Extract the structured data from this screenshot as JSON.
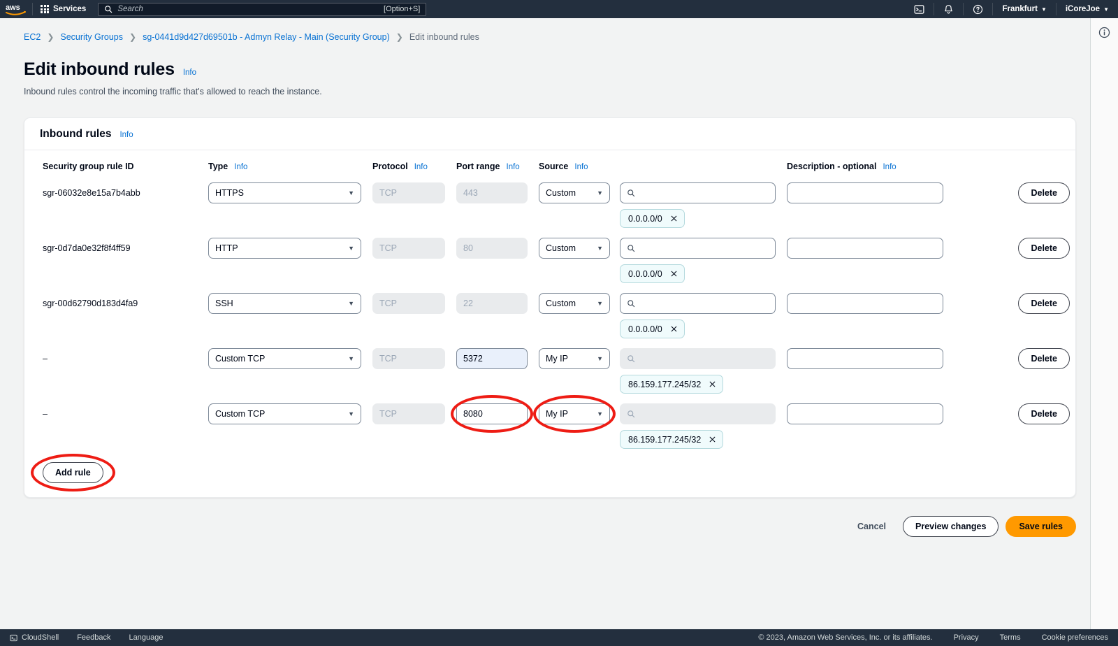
{
  "topnav": {
    "logo": "aws-logo",
    "services_label": "Services",
    "search_placeholder": "Search",
    "search_value": "",
    "search_shortcut": "[Option+S]",
    "cloudshell_icon": "cloudshell-icon",
    "notifications_icon": "bell-icon",
    "help_icon": "question-circle-icon",
    "region_label": "Frankfurt",
    "account_label": "iCoreJoe"
  },
  "breadcrumb": {
    "items": [
      {
        "label": "EC2",
        "link": true
      },
      {
        "label": "Security Groups",
        "link": true
      },
      {
        "label": "sg-0441d9d427d69501b - Admyn Relay - Main (Security Group)",
        "link": true
      },
      {
        "label": "Edit inbound rules",
        "link": false
      }
    ],
    "separator": "❯"
  },
  "page": {
    "title": "Edit inbound rules",
    "title_info": "Info",
    "subtitle": "Inbound rules control the incoming traffic that's allowed to reach the instance."
  },
  "right_rail": {
    "info_icon": "info-circle-icon"
  },
  "panel": {
    "heading": "Inbound rules",
    "heading_info": "Info",
    "columns": [
      {
        "label": "Security group rule ID",
        "info": null
      },
      {
        "label": "Type",
        "info": "Info"
      },
      {
        "label": "Protocol",
        "info": "Info"
      },
      {
        "label": "Port range",
        "info": "Info"
      },
      {
        "label": "Source",
        "info": "Info"
      },
      {
        "label": "Description - optional",
        "info": "Info"
      },
      {
        "label": "",
        "info": null
      }
    ],
    "rows": [
      {
        "rule_id": "sgr-06032e8e15a7b4abb",
        "type": "HTTPS",
        "protocol": "TCP",
        "protocol_disabled": true,
        "port": "443",
        "port_disabled": true,
        "port_edited": false,
        "source_select": "Custom",
        "source_search": "",
        "source_search_disabled": false,
        "chip": "0.0.0.0/0",
        "description": "",
        "delete_label": "Delete"
      },
      {
        "rule_id": "sgr-0d7da0e32f8f4ff59",
        "type": "HTTP",
        "protocol": "TCP",
        "protocol_disabled": true,
        "port": "80",
        "port_disabled": true,
        "port_edited": false,
        "source_select": "Custom",
        "source_search": "",
        "source_search_disabled": false,
        "chip": "0.0.0.0/0",
        "description": "",
        "delete_label": "Delete"
      },
      {
        "rule_id": "sgr-00d62790d183d4fa9",
        "type": "SSH",
        "protocol": "TCP",
        "protocol_disabled": true,
        "port": "22",
        "port_disabled": true,
        "port_edited": false,
        "source_select": "Custom",
        "source_search": "",
        "source_search_disabled": false,
        "chip": "0.0.0.0/0",
        "description": "",
        "delete_label": "Delete"
      },
      {
        "rule_id": "–",
        "type": "Custom TCP",
        "protocol": "TCP",
        "protocol_disabled": true,
        "port": "5372",
        "port_disabled": false,
        "port_edited": true,
        "source_select": "My IP",
        "source_search": "",
        "source_search_disabled": true,
        "chip": "86.159.177.245/32",
        "description": "",
        "delete_label": "Delete"
      },
      {
        "rule_id": "–",
        "type": "Custom TCP",
        "protocol": "TCP",
        "protocol_disabled": true,
        "port": "8080",
        "port_disabled": false,
        "port_edited": false,
        "source_select": "My IP",
        "source_search": "",
        "source_search_disabled": true,
        "chip": "86.159.177.245/32",
        "description": "",
        "delete_label": "Delete"
      }
    ],
    "add_rule_label": "Add rule"
  },
  "actions": {
    "cancel_label": "Cancel",
    "preview_label": "Preview changes",
    "save_label": "Save rules"
  },
  "annotations": {
    "color": "#ee1c14",
    "targets": [
      "port-range-row-5",
      "source-type-row-5",
      "add-rule-button"
    ]
  },
  "footer": {
    "cloudshell_label": "CloudShell",
    "feedback_label": "Feedback",
    "language_label": "Language",
    "copyright": "© 2023, Amazon Web Services, Inc. or its affiliates.",
    "privacy_label": "Privacy",
    "terms_label": "Terms",
    "cookie_label": "Cookie preferences"
  },
  "colors": {
    "nav_bg": "#232f3e",
    "link": "#0972d3",
    "primary_button": "#ff9900",
    "chip_bg": "#f0fbfc",
    "annotation": "#ee1c14"
  }
}
